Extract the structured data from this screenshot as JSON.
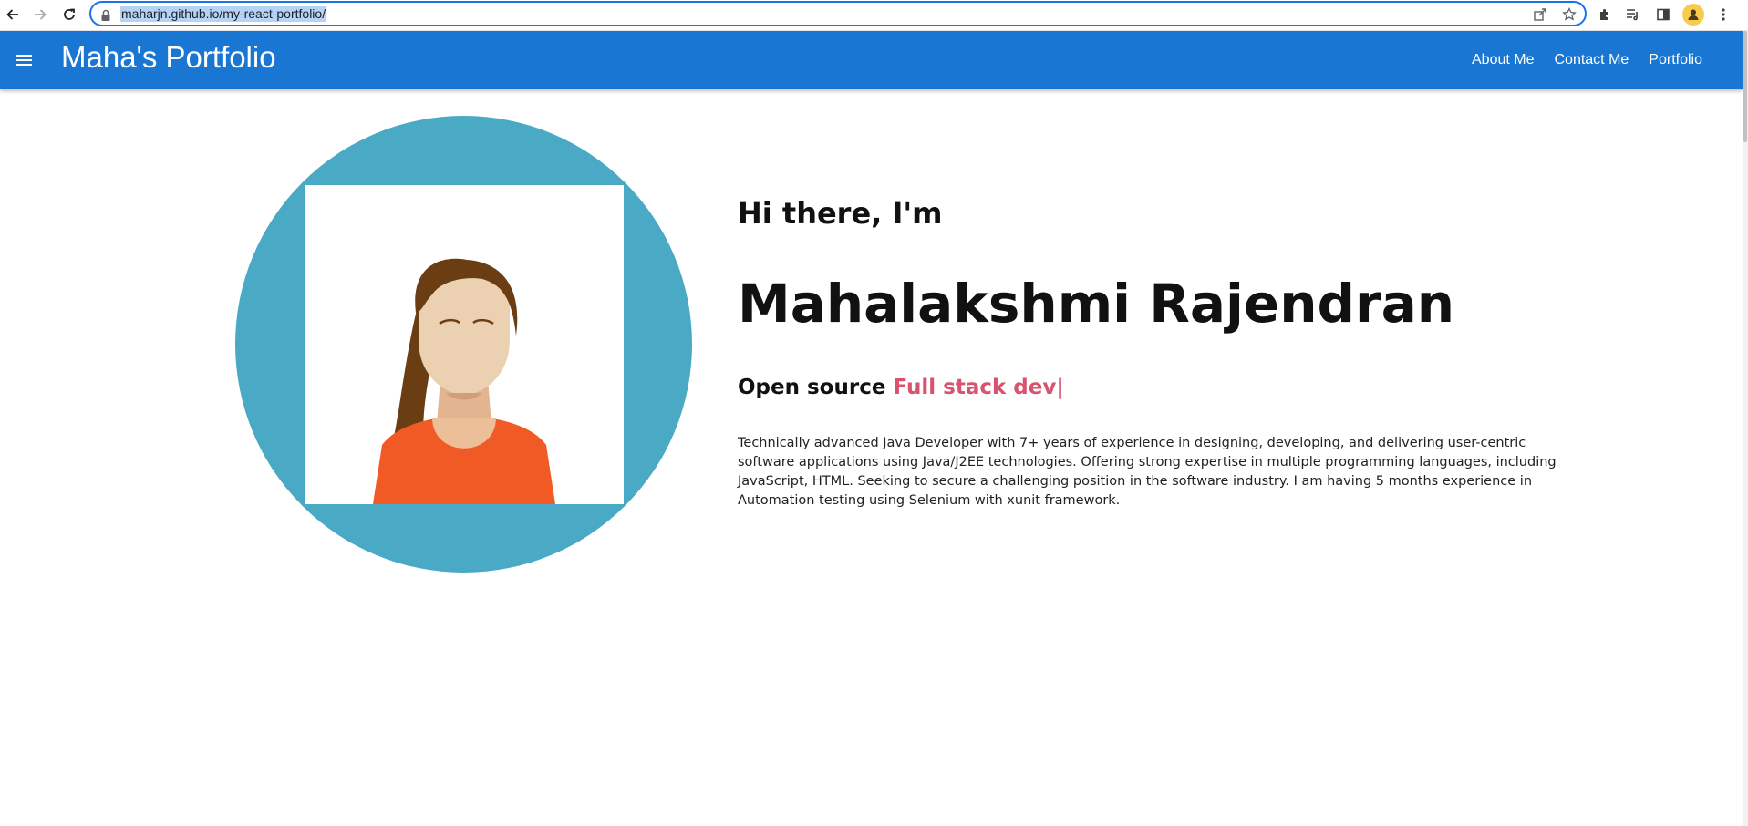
{
  "browser": {
    "url": "maharjn.github.io/my-react-portfolio/"
  },
  "colors": {
    "appbar": "#1976d2",
    "avatar_bg": "#4aa9c4",
    "accent_text": "#d9526e"
  },
  "appbar": {
    "brand": "Maha's Portfolio",
    "links": [
      "About Me",
      "Contact Me",
      "Portfolio"
    ]
  },
  "hero": {
    "greeting": "Hi there, I'm",
    "name": "Mahalakshmi Rajendran",
    "tagline_prefix": "Open source",
    "tagline_accent": "Full stack dev|",
    "bio": "Technically advanced Java Developer with 7+ years of experience in designing, developing, and delivering user-centric software applications using Java/J2EE technologies. Offering strong expertise in multiple programming languages, including JavaScript, HTML. Seeking to secure a challenging position in the software industry. I am having 5 months experience in Automation testing using Selenium with xunit framework."
  },
  "icons": {
    "back": "back-arrow-icon",
    "forward": "forward-arrow-icon",
    "reload": "reload-icon",
    "lock": "lock-icon",
    "share": "share-icon",
    "bookmark": "star-icon",
    "extensions": "puzzle-icon",
    "media": "media-control-icon",
    "sidepanel": "side-panel-icon",
    "profile": "profile-icon",
    "more": "kebab-menu-icon",
    "menu": "hamburger-menu-icon"
  }
}
